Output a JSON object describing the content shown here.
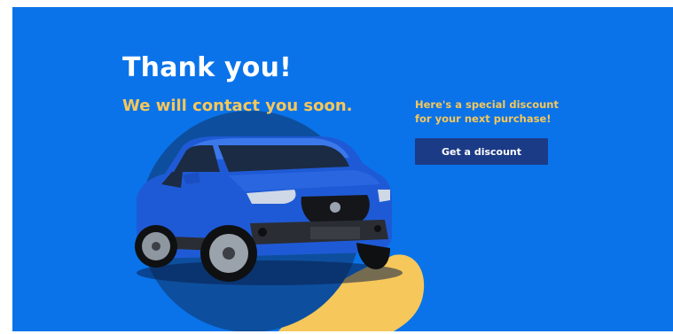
{
  "hero": {
    "title": "Thank you!",
    "subtitle": "We will contact you soon."
  },
  "offer": {
    "text": "Here's a special discount for your next purchase!",
    "button_label": "Get a discount"
  },
  "colors": {
    "background": "#0a73ea",
    "circle": "#0d4f9e",
    "accent_yellow": "#f6c75a",
    "button": "#1c3b86",
    "car_body": "#1f5ad6"
  }
}
